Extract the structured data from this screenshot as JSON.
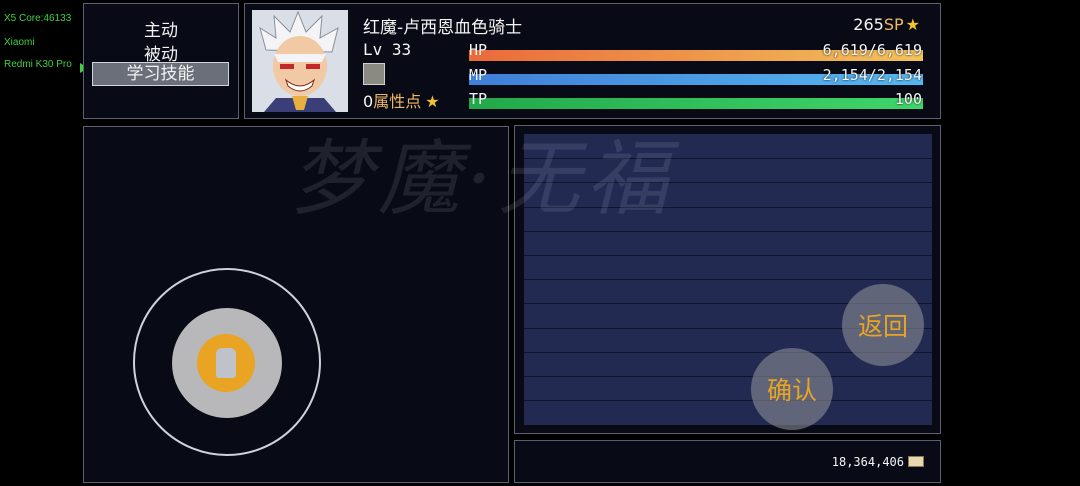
{
  "debug": {
    "line1": "X5 Core:46133",
    "line2": "Xiaomi",
    "line3": "Redmi K30 Pro"
  },
  "menu": {
    "items": [
      "主动",
      "被动",
      "学习技能"
    ],
    "selected_index": 2
  },
  "character": {
    "name": "红魔-卢西恩血色骑士",
    "level_label": "Lv",
    "level": "33",
    "attribute_points": "0",
    "attribute_label": "属性点",
    "sp_value": "265",
    "sp_unit": "SP",
    "hp_label": "HP",
    "hp_text": "6,619/6,619",
    "hp_fraction": 1.0,
    "mp_label": "MP",
    "mp_text": "2,154/2,154",
    "mp_fraction": 1.0,
    "tp_label": "TP",
    "tp_text": "100",
    "tp_fraction": 1.0
  },
  "gold": {
    "amount": "18,364,406"
  },
  "buttons": {
    "back": "返回",
    "confirm": "确认"
  },
  "watermark": "梦魔·无福",
  "colors": {
    "hp_start": "#ea6a3a",
    "hp_end": "#f3c25a",
    "mp_start": "#3f7fd8",
    "mp_end": "#55b8f0",
    "tp_start": "#22a84a",
    "tp_end": "#3fd66a",
    "accent": "#e8a422"
  }
}
